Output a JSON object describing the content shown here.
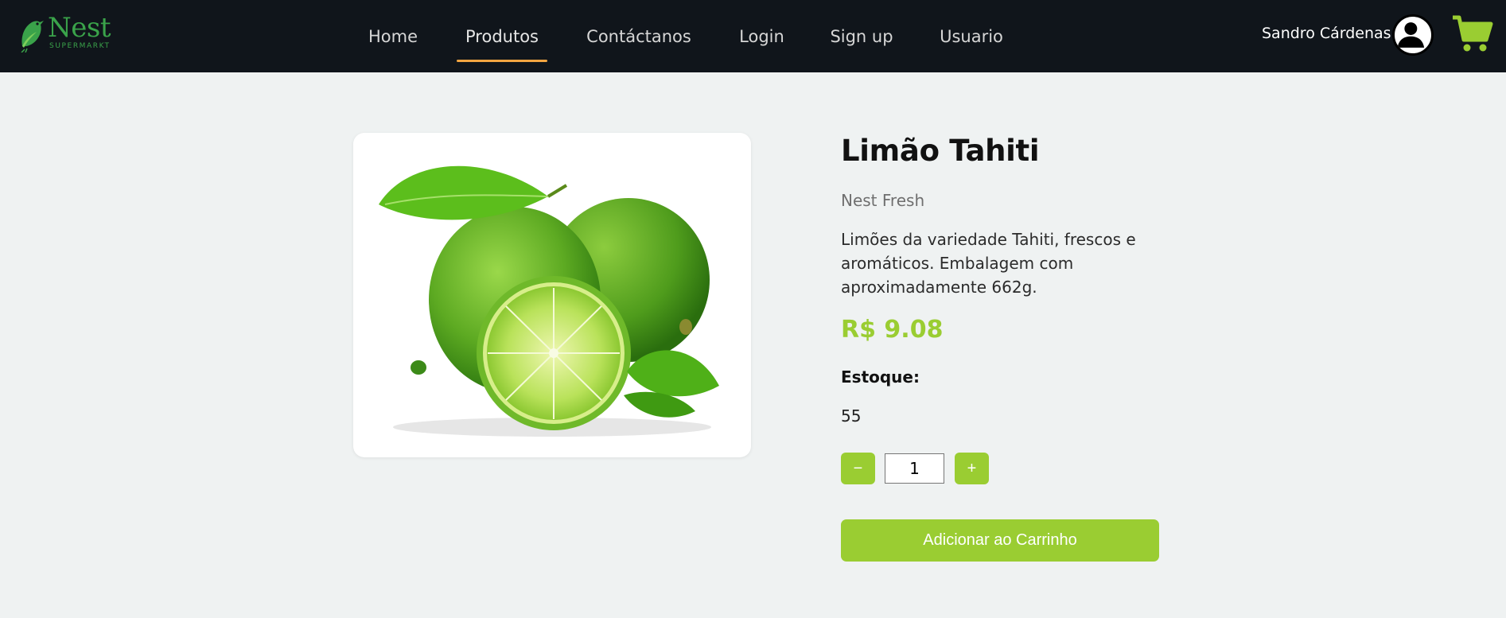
{
  "brand": {
    "name": "Nest",
    "tagline": "SUPERMARKT",
    "accent_color": "#3aa34a"
  },
  "nav": {
    "items": [
      {
        "label": "Home",
        "active": false
      },
      {
        "label": "Produtos",
        "active": true
      },
      {
        "label": "Contáctanos",
        "active": false
      },
      {
        "label": "Login",
        "active": false
      },
      {
        "label": "Sign up",
        "active": false
      },
      {
        "label": "Usuario",
        "active": false
      }
    ],
    "active_underline_color": "#f2a541"
  },
  "user": {
    "name": "Sandro Cárdenas",
    "avatar_icon": "user-avatar-icon"
  },
  "cart": {
    "icon": "shopping-cart-icon",
    "color": "#9acd32"
  },
  "product": {
    "title": "Limão Tahiti",
    "brand": "Nest Fresh",
    "description": "Limões da variedade Tahiti, frescos e aromáticos. Embalagem com aproximadamente 662g.",
    "price": "R$ 9.08",
    "stock_label": "Estoque:",
    "stock_value": "55",
    "quantity": "1",
    "decrement_label": "−",
    "increment_label": "+",
    "add_to_cart_label": "Adicionar ao Carrinho",
    "accent_color": "#9acd32"
  }
}
